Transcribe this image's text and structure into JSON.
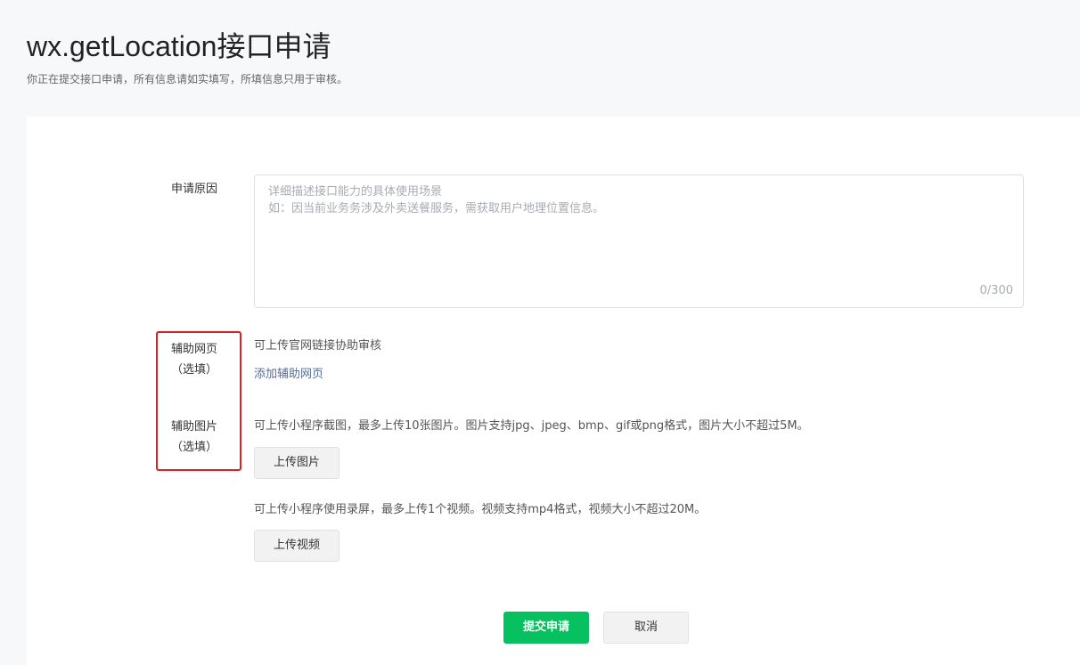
{
  "header": {
    "title": "wx.getLocation接口申请",
    "subtitle": "你正在提交接口申请，所有信息请如实填写，所填信息只用于审核。"
  },
  "form": {
    "reason": {
      "label": "申请原因",
      "placeholder": "详细描述接口能力的具体使用场景\n如：因当前业务务涉及外卖送餐服务，需获取用户地理位置信息。",
      "counter": "0/300",
      "value": ""
    },
    "web": {
      "label": "辅助网页\n（选填）",
      "hint": "可上传官网链接协助审核",
      "add_link": "添加辅助网页"
    },
    "images": {
      "label": "辅助图片\n（选填）",
      "hint": "可上传小程序截图，最多上传10张图片。图片支持jpg、jpeg、bmp、gif或png格式，图片大小不超过5M。",
      "upload_label": "上传图片"
    },
    "video": {
      "hint": "可上传小程序使用录屏，最多上传1个视频。视频支持mp4格式，视频大小不超过20M。",
      "upload_label": "上传视频"
    }
  },
  "actions": {
    "submit_label": "提交申请",
    "cancel_label": "取消"
  },
  "colors": {
    "primary": "#07c160",
    "link": "#576b95",
    "highlight": "#e02020"
  }
}
